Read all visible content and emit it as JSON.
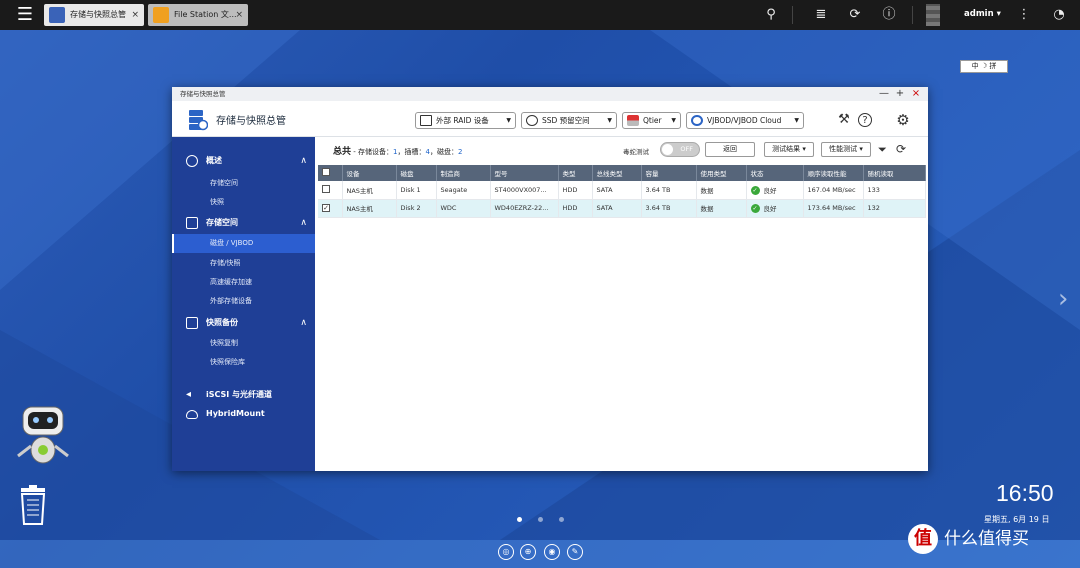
{
  "topbar": {
    "menu_icon": "hamburger-icon",
    "tabs": [
      {
        "label": "存储与快照总管",
        "close": "×",
        "icon": "storage-icon"
      },
      {
        "label": "File Station 文...",
        "close": "×",
        "icon": "folder-icon"
      }
    ],
    "user": "admin ▾",
    "icons": [
      "search-icon",
      "stack-icon",
      "sync-icon",
      "info-icon",
      "more-icon",
      "dashboard-icon"
    ]
  },
  "window": {
    "title": "存储与快照总管",
    "controls": [
      "—",
      "+",
      "×"
    ],
    "app_title": "存储与快照总管",
    "toolbar": {
      "raid": "外部 RAID 设备",
      "ssd": "SSD 预留空间",
      "qtier": "Qtier",
      "vjbod": "VJBOD/VJBOD Cloud"
    }
  },
  "sidebar": {
    "groups": [
      {
        "label": "概述",
        "chevron": "∧",
        "items": [
          "存储空间",
          "快照"
        ]
      },
      {
        "label": "存储空间",
        "chevron": "∧",
        "items": [
          "磁盘 / VJBOD",
          "存储/快照",
          "高速缓存加速",
          "外部存储设备"
        ]
      },
      {
        "label": "快照备份",
        "chevron": "∧",
        "items": [
          "快照复制",
          "快照保险库"
        ]
      },
      {
        "label": "iSCSI 与光纤通道"
      },
      {
        "label": "HybridMount"
      }
    ]
  },
  "content": {
    "summary_title": "总共",
    "summary_text1": "- 存储设备：",
    "summary_devices": "1",
    "summary_text2": "，插槽：",
    "summary_slots": "4",
    "summary_text3": "，磁盘：",
    "summary_disks": "2",
    "toggle_label": "毒蛇测试",
    "toggle_state": "OFF",
    "btn_back": "返回",
    "btn_results": "测试结果 ▾",
    "btn_perf": "性能测试 ▾",
    "columns": [
      "设备",
      "磁盘",
      "制造商",
      "型号",
      "类型",
      "总线类型",
      "容量",
      "使用类型",
      "状态",
      "顺序读取性能",
      "随机读取"
    ],
    "rows": [
      {
        "checked": "",
        "device": "NAS主机",
        "disk": "Disk 1",
        "vendor": "Seagate",
        "model": "ST4000VX007...",
        "type": "HDD",
        "bus": "SATA",
        "capacity": "3.64 TB",
        "usage": "数据",
        "status": "良好",
        "seq": "167.04 MB/sec",
        "rand": "133"
      },
      {
        "checked": "✓",
        "device": "NAS主机",
        "disk": "Disk 2",
        "vendor": "WDC",
        "model": "WD40EZRZ-22...",
        "type": "HDD",
        "bus": "SATA",
        "capacity": "3.64 TB",
        "usage": "数据",
        "status": "良好",
        "seq": "173.64 MB/sec",
        "rand": "132"
      }
    ]
  },
  "desktop": {
    "time": "16:50",
    "date": "星期五, 6月 19 日",
    "ime": "中 ☽ 拼",
    "watermark": "什么值得买",
    "watermark_badge": "值"
  }
}
